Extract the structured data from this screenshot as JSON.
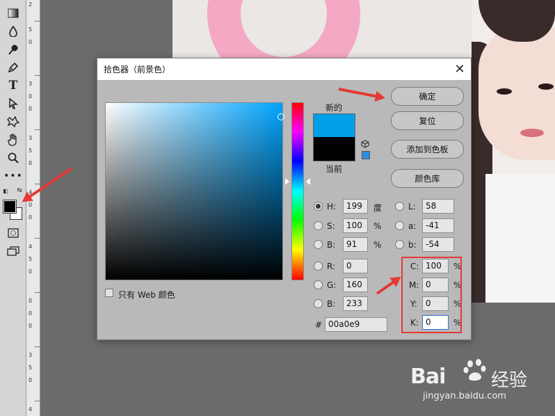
{
  "dialog": {
    "title": "拾色器（前景色）",
    "close_symbol": "✕",
    "buttons": {
      "ok": "确定",
      "reset": "复位",
      "add_to_swatches": "添加到色板",
      "color_libraries": "颜色库"
    },
    "new_label": "新的",
    "current_label": "当前",
    "new_color": "#00a0e9",
    "current_color": "#000000",
    "only_web_colors_label": "只有 Web 颜色",
    "only_web_colors_checked": false,
    "fields": {
      "H": {
        "label": "H:",
        "value": "199",
        "unit": "度",
        "selected": true
      },
      "S": {
        "label": "S:",
        "value": "100",
        "unit": "%"
      },
      "Bri": {
        "label": "B:",
        "value": "91",
        "unit": "%"
      },
      "R": {
        "label": "R:",
        "value": "0"
      },
      "G": {
        "label": "G:",
        "value": "160"
      },
      "B": {
        "label": "B:",
        "value": "233"
      },
      "L": {
        "label": "L:",
        "value": "58"
      },
      "a": {
        "label": "a:",
        "value": "-41"
      },
      "b": {
        "label": "b:",
        "value": "-54"
      },
      "C": {
        "label": "C:",
        "value": "100",
        "unit": "%"
      },
      "M": {
        "label": "M:",
        "value": "0",
        "unit": "%"
      },
      "Y": {
        "label": "Y:",
        "value": "0",
        "unit": "%"
      },
      "K": {
        "label": "K:",
        "value": "0",
        "unit": "%"
      }
    },
    "hex_label": "#",
    "hex_value": "00a0e9"
  },
  "toolbar": {
    "tools": [
      "gradient-icon",
      "blur-icon",
      "dodge-icon",
      "pen-icon",
      "type-icon",
      "path-select-icon",
      "custom-shape-icon",
      "hand-icon",
      "zoom-icon",
      "more-icon"
    ],
    "foreground": "#000000",
    "background": "#ffffff"
  },
  "ruler": {
    "labels": [
      "2",
      "5",
      "0",
      "3",
      "0",
      "0",
      "3",
      "5",
      "0",
      "4",
      "0",
      "0",
      "4",
      "5",
      "0",
      "0",
      "0",
      "0",
      "3",
      "5",
      "0",
      "4"
    ]
  },
  "watermark": {
    "brand": "Bai",
    "url": "jingyan.baidu.com"
  },
  "colors": {
    "annotation_red": "#e53935",
    "dialog_bg": "#b9b9b9",
    "accent_blue": "#2c6fd6"
  }
}
